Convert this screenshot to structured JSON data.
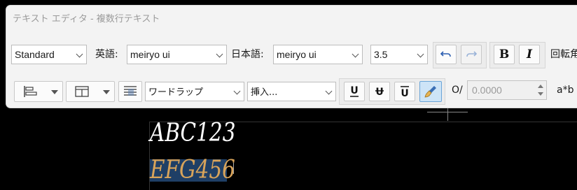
{
  "window": {
    "title": "テキスト エディタ - 複数行テキスト"
  },
  "row1": {
    "style": "Standard",
    "english_label": "英語:",
    "english_font": "meiryo ui",
    "japanese_label": "日本語:",
    "japanese_font": "meiryo ui",
    "height": "3.5",
    "bold": "B",
    "italic": "I",
    "rotation_label": "回転角"
  },
  "row2": {
    "wrap_mode": "ワードラップ",
    "insert": "挿入...",
    "oblique_label": "O/",
    "oblique_value": "0.0000",
    "fraction_label": "a*b"
  },
  "canvas": {
    "line1": "ABC123",
    "line2": "EFG456"
  },
  "colors": {
    "selection": "#1f3f66",
    "selected_text": "#d9a45a",
    "active_button": "#cde4f7"
  }
}
